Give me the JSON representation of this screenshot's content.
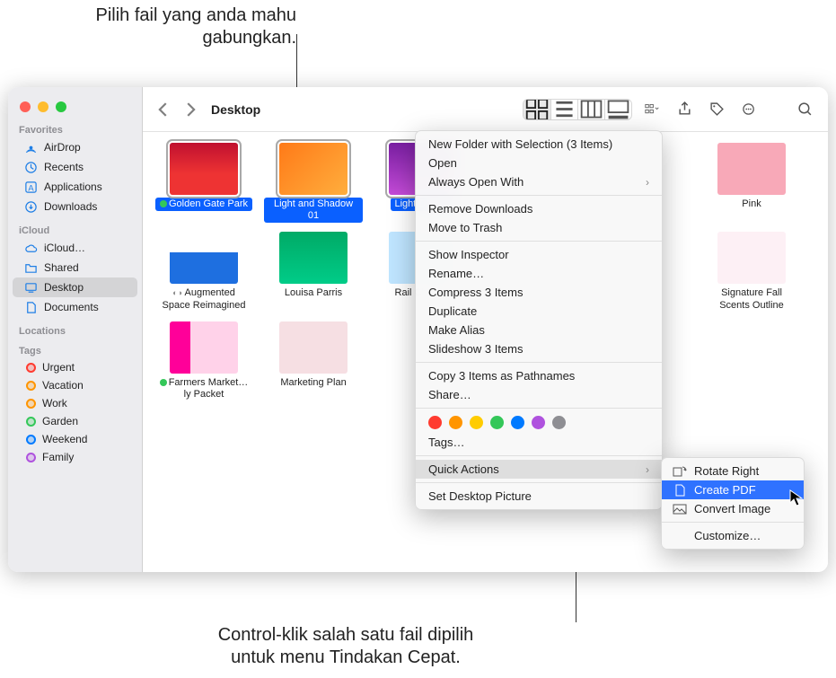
{
  "callouts": {
    "top": "Pilih fail yang anda mahu gabungkan.",
    "bottom_l1": "Control-klik salah satu fail dipilih",
    "bottom_l2": "untuk menu Tindakan Cepat."
  },
  "window_title": "Desktop",
  "sidebar": {
    "sections": {
      "favorites": "Favorites",
      "icloud": "iCloud",
      "locations": "Locations",
      "tags": "Tags"
    },
    "favorites": [
      {
        "label": "AirDrop",
        "icon": "airdrop"
      },
      {
        "label": "Recents",
        "icon": "clock"
      },
      {
        "label": "Applications",
        "icon": "apps"
      },
      {
        "label": "Downloads",
        "icon": "download"
      }
    ],
    "icloud": [
      {
        "label": "iCloud…",
        "icon": "cloud"
      },
      {
        "label": "Shared",
        "icon": "folder"
      },
      {
        "label": "Desktop",
        "icon": "desktop",
        "selected": true
      },
      {
        "label": "Documents",
        "icon": "doc"
      }
    ],
    "tags": [
      {
        "label": "Urgent",
        "color": "#ff3b30"
      },
      {
        "label": "Vacation",
        "color": "#ff9500"
      },
      {
        "label": "Work",
        "color": "#ff9500"
      },
      {
        "label": "Garden",
        "color": "#34c759"
      },
      {
        "label": "Weekend",
        "color": "#007aff"
      },
      {
        "label": "Family",
        "color": "#af52de"
      }
    ]
  },
  "files": [
    {
      "name": "Golden Gate Park",
      "selected": true,
      "status": "#34c759",
      "thumb": "th-red"
    },
    {
      "name": "Light and Shadow 01",
      "selected": true,
      "thumb": "th-orange"
    },
    {
      "name": "Light Display",
      "selected": true,
      "thumb": "th-purple"
    },
    {
      "name": "",
      "thumb": ""
    },
    {
      "name": "",
      "thumb": ""
    },
    {
      "name": "Pink",
      "thumb": "th-pink"
    },
    {
      "name": "Augmented Space Reimagined",
      "thumb": "th-bluewhite",
      "shared": true
    },
    {
      "name": "Louisa Parris",
      "thumb": "th-teal"
    },
    {
      "name": "Rail Chasers",
      "thumb": "th-sky"
    },
    {
      "name": "",
      "thumb": ""
    },
    {
      "name": "",
      "thumb": ""
    },
    {
      "name": "Signature Fall Scents Outline",
      "thumb": "th-signature"
    },
    {
      "name": "Farmers Market…ly Packet",
      "status": "#34c759",
      "thumb": "th-farmers"
    },
    {
      "name": "Marketing Plan",
      "thumb": "th-plan"
    }
  ],
  "context_menu": {
    "items1": [
      "New Folder with Selection (3 Items)",
      "Open"
    ],
    "always_open": "Always Open With",
    "items2": [
      "Remove Downloads",
      "Move to Trash"
    ],
    "items3": [
      "Show Inspector",
      "Rename…",
      "Compress 3 Items",
      "Duplicate",
      "Make Alias",
      "Slideshow 3 Items"
    ],
    "items4": [
      "Copy 3 Items as Pathnames",
      "Share…"
    ],
    "tags": "Tags…",
    "quick_actions": "Quick Actions",
    "set_desktop": "Set Desktop Picture",
    "colors": [
      "#ff3b30",
      "#ff9500",
      "#ffcc00",
      "#34c759",
      "#007aff",
      "#af52de",
      "#8e8e93"
    ]
  },
  "submenu": {
    "rotate": "Rotate Right",
    "create_pdf": "Create PDF",
    "convert": "Convert Image",
    "customize": "Customize…"
  }
}
